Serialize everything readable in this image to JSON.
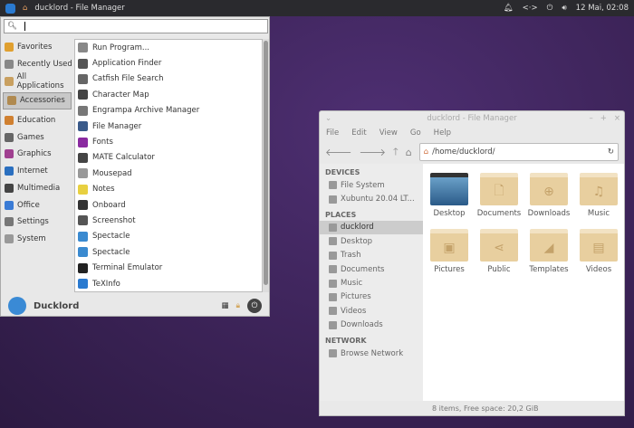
{
  "panel": {
    "title": "ducklord - File Manager",
    "clock": "12 Mai, 02:08"
  },
  "menu": {
    "search_value": "",
    "categories": [
      {
        "label": "Favorites",
        "color": "#e0a030"
      },
      {
        "label": "Recently Used",
        "color": "#888"
      },
      {
        "label": "All Applications",
        "color": "#c9a060"
      },
      {
        "label": "Accessories",
        "color": "#b08a50",
        "selected": true
      },
      {
        "label": "Education",
        "color": "#d08030"
      },
      {
        "label": "Games",
        "color": "#666"
      },
      {
        "label": "Graphics",
        "color": "#a04090"
      },
      {
        "label": "Internet",
        "color": "#2a6fbf"
      },
      {
        "label": "Multimedia",
        "color": "#444"
      },
      {
        "label": "Office",
        "color": "#3a7bd5"
      },
      {
        "label": "Settings",
        "color": "#777"
      },
      {
        "label": "System",
        "color": "#999"
      }
    ],
    "apps": [
      {
        "label": "Run Program...",
        "color": "#888"
      },
      {
        "label": "Application Finder",
        "color": "#555"
      },
      {
        "label": "Catfish File Search",
        "color": "#666"
      },
      {
        "label": "Character Map",
        "color": "#444"
      },
      {
        "label": "Engrampa Archive Manager",
        "color": "#777"
      },
      {
        "label": "File Manager",
        "color": "#3a5a8a"
      },
      {
        "label": "Fonts",
        "color": "#8a2aa0"
      },
      {
        "label": "MATE Calculator",
        "color": "#444"
      },
      {
        "label": "Mousepad",
        "color": "#999"
      },
      {
        "label": "Notes",
        "color": "#e8d040"
      },
      {
        "label": "Onboard",
        "color": "#333"
      },
      {
        "label": "Screenshot",
        "color": "#555"
      },
      {
        "label": "Spectacle",
        "color": "#3a8ad0"
      },
      {
        "label": "Spectacle",
        "color": "#3a8ad0"
      },
      {
        "label": "Terminal Emulator",
        "color": "#222"
      },
      {
        "label": "TeXInfo",
        "color": "#2a7ad0"
      }
    ],
    "user": "Ducklord"
  },
  "fm": {
    "title": "ducklord - File Manager",
    "menu": [
      "File",
      "Edit",
      "View",
      "Go",
      "Help"
    ],
    "path": "/home/ducklord/",
    "sections": [
      {
        "header": "DEVICES",
        "items": [
          "File System",
          "Xubuntu 20.04 LT..."
        ]
      },
      {
        "header": "PLACES",
        "items": [
          "ducklord",
          "Desktop",
          "Trash",
          "Documents",
          "Music",
          "Pictures",
          "Videos",
          "Downloads"
        ]
      },
      {
        "header": "NETWORK",
        "items": [
          "Browse Network"
        ]
      }
    ],
    "folders": [
      {
        "label": "Desktop",
        "glyph": ""
      },
      {
        "label": "Documents",
        "glyph": "🗋"
      },
      {
        "label": "Downloads",
        "glyph": "⊕"
      },
      {
        "label": "Music",
        "glyph": "♫"
      },
      {
        "label": "Pictures",
        "glyph": "▣"
      },
      {
        "label": "Public",
        "glyph": "⋖"
      },
      {
        "label": "Templates",
        "glyph": "◢"
      },
      {
        "label": "Videos",
        "glyph": "▤"
      }
    ],
    "status": "8 items, Free space: 20,2 GiB"
  }
}
